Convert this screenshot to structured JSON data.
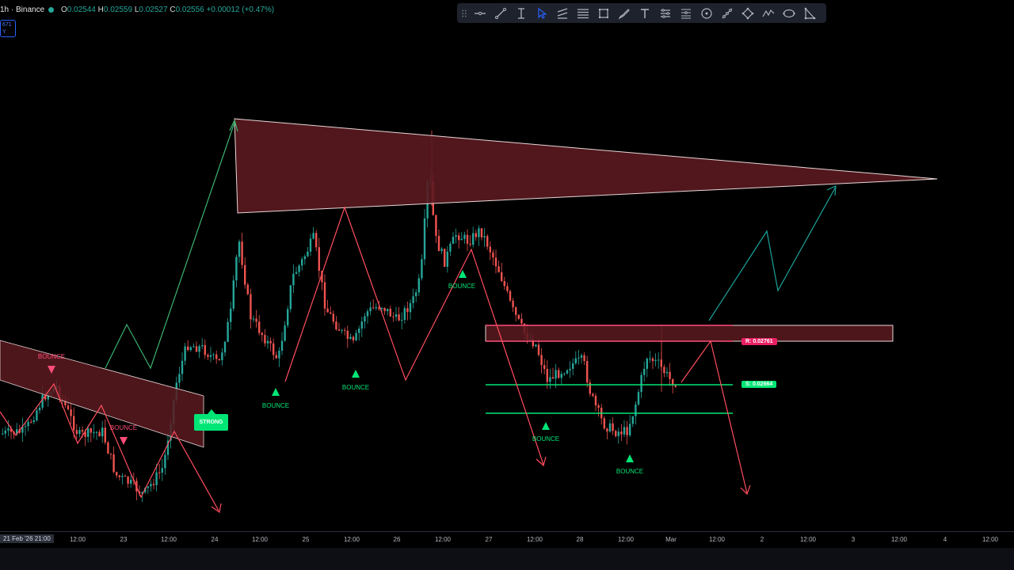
{
  "header": {
    "symbol": "1h · Binance",
    "ohlc": [
      {
        "key": "O",
        "value": "0.02544"
      },
      {
        "key": "H",
        "value": "0.02559"
      },
      {
        "key": "L",
        "value": "0.02527"
      },
      {
        "key": "C",
        "value": "0.02556"
      }
    ],
    "change": "+0.00012 (+0.47%)"
  },
  "mini_badge": {
    "line1": "671",
    "line2": "Y"
  },
  "toolbar": [
    "drag-handle-icon",
    "horizontal-line-icon",
    "trend-line-icon",
    "text-cursor-icon",
    "cursor-arrow-icon",
    "parallel-channel-icon",
    "fib-retracement-icon",
    "rectangle-icon",
    "brush-icon",
    "text-icon",
    "lines-group-icon",
    "lines-group-2-icon",
    "circle-icon",
    "measure-icon",
    "diamond-node-icon",
    "zigzag-icon",
    "ellipse-icon",
    "triangle-icon"
  ],
  "x_axis_ticks": [
    "21 Feb '26  21:00",
    "12:00",
    "23",
    "12:00",
    "24",
    "12:00",
    "25",
    "12:00",
    "26",
    "12:00",
    "27",
    "12:00",
    "28",
    "12:00",
    "Mar",
    "12:00",
    "2",
    "12:00",
    "3",
    "12:00",
    "4",
    "12:00"
  ],
  "labels": {
    "bounce": "BOUNCE",
    "strong": "STRONG",
    "resistance": "R: 0.02761",
    "support": "S: 0.02664"
  },
  "colors": {
    "up": "#26a69a",
    "down": "#ef5350",
    "bounce_green": "#00e676",
    "bounce_red": "#ff4d7a",
    "zone_fill": "#5a1a20",
    "path_red": "#ff4d5e",
    "path_green": "#3cb371",
    "path_teal": "#1aa39a"
  }
}
